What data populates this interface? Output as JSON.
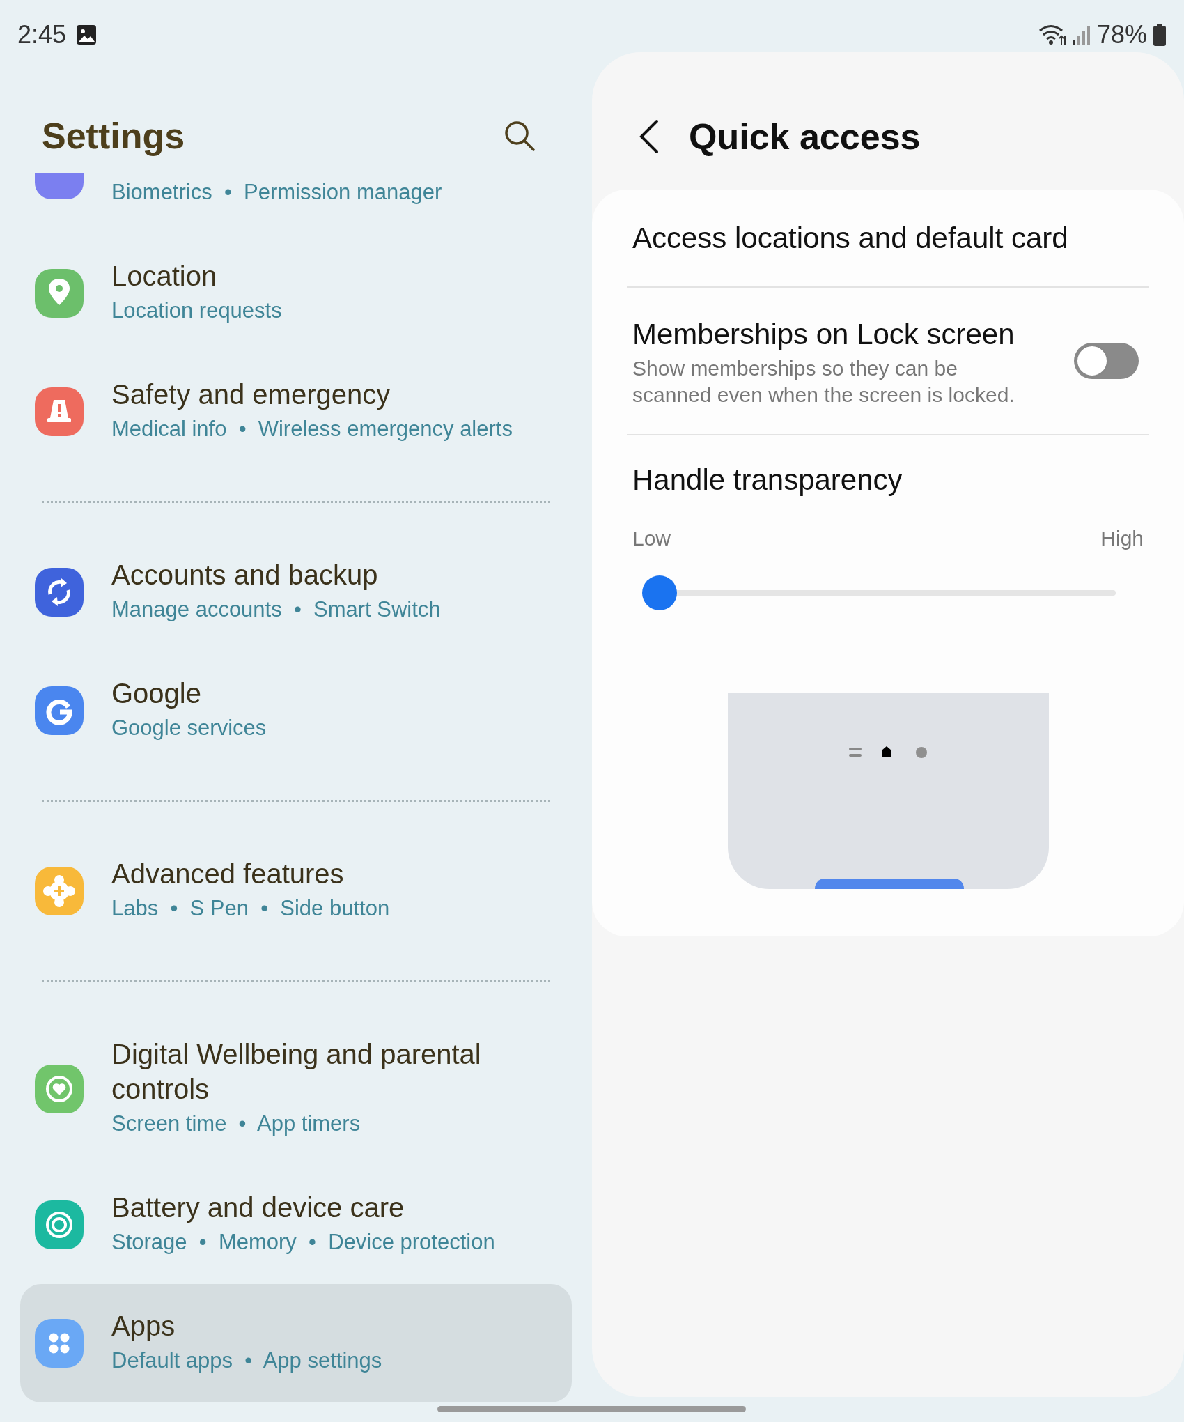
{
  "status_bar": {
    "time": "2:45",
    "battery": "78%"
  },
  "settings": {
    "title": "Settings",
    "groups": [
      [
        {
          "subtitle": "Biometrics  •  Permission manager",
          "color": "#7b7ff0",
          "selected": false
        },
        {
          "title": "Location",
          "subtitle": "Location requests",
          "color": "#6cbf6b",
          "selected": false
        },
        {
          "title": "Safety and emergency",
          "subtitle": "Medical info  •  Wireless emergency alerts",
          "color": "#ee6b5e",
          "selected": false
        }
      ],
      [
        {
          "title": "Accounts and backup",
          "subtitle": "Manage accounts  •  Smart Switch",
          "color": "#3f63dc",
          "selected": false
        },
        {
          "title": "Google",
          "subtitle": "Google services",
          "color": "#4a86ef",
          "selected": false
        }
      ],
      [
        {
          "title": "Advanced features",
          "subtitle": "Labs  •  S Pen  •  Side button",
          "color": "#f8b93a",
          "selected": false
        }
      ],
      [
        {
          "title": "Digital Wellbeing and parental controls",
          "subtitle": "Screen time  •  App timers",
          "color": "#71c56b",
          "selected": false
        },
        {
          "title": "Battery and device care",
          "subtitle": "Storage  •  Memory  •  Device protection",
          "color": "#1cb9a0",
          "selected": false
        },
        {
          "title": "Apps",
          "subtitle": "Default apps  •  App settings",
          "color": "#6aa8f5",
          "selected": true
        }
      ]
    ]
  },
  "quick_access": {
    "title": "Quick access",
    "access_locations": "Access locations and default card",
    "memberships": {
      "title": "Memberships on Lock screen",
      "description": "Show memberships so they can be scanned even when the screen is locked.",
      "on": false
    },
    "handle_transparency": {
      "title": "Handle transparency",
      "low": "Low",
      "high": "High",
      "level": 0
    }
  }
}
